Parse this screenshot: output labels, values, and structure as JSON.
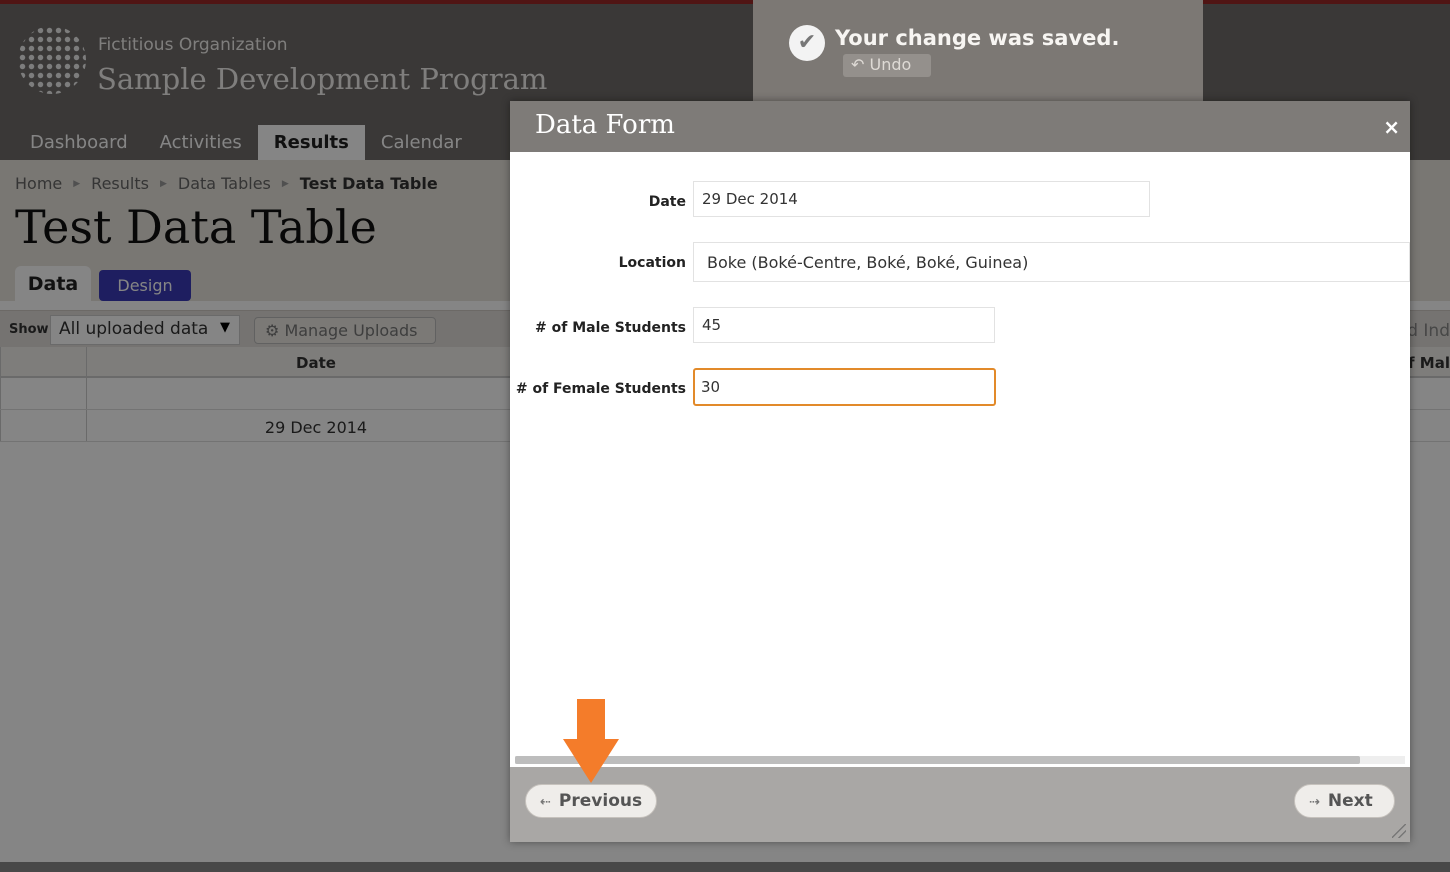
{
  "header": {
    "org_name": "Fictitious Organization",
    "program_name": "Sample Development Program"
  },
  "nav": {
    "items": [
      {
        "label": "Dashboard"
      },
      {
        "label": "Activities"
      },
      {
        "label": "Results",
        "active": true
      },
      {
        "label": "Calendar"
      }
    ]
  },
  "breadcrumb": {
    "items": [
      "Home",
      "Results",
      "Data Tables"
    ],
    "current": "Test Data Table"
  },
  "page": {
    "title": "Test Data Table",
    "tabs": [
      {
        "label": "Data",
        "active": true
      },
      {
        "label": "Design"
      }
    ]
  },
  "toolbar": {
    "show_label": "Show",
    "show_value": "All uploaded data",
    "manage_uploads": "Manage Uploads",
    "right_cut": "d Ind"
  },
  "table": {
    "columns": [
      "Date"
    ],
    "right_cut_header": "of Mal",
    "rows": [
      {
        "date": ""
      },
      {
        "date": "29 Dec 2014"
      }
    ]
  },
  "toast": {
    "message": "Your change was saved.",
    "undo_label": "Undo"
  },
  "modal": {
    "title": "Data Form",
    "close": "×",
    "fields": [
      {
        "label": "Date",
        "value": "29 Dec 2014"
      },
      {
        "label": "Location",
        "value": "Boke (Boké-Centre, Boké, Boké, Guinea)"
      },
      {
        "label": "# of Male Students",
        "value": "45"
      },
      {
        "label": "# of Female Students",
        "value": "30"
      }
    ],
    "previous_label": "Previous",
    "next_label": "Next"
  },
  "colors": {
    "accent_focus": "#e28a2a",
    "hint_arrow": "#f47c2a",
    "design_tab": "#3a3ab8"
  }
}
